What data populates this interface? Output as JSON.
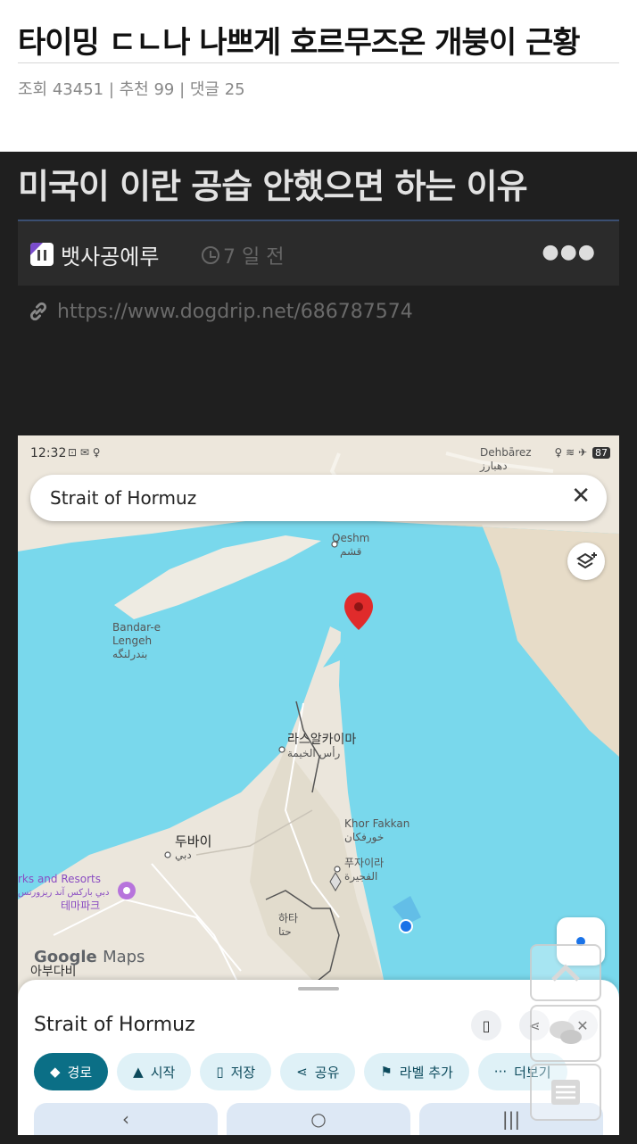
{
  "post": {
    "title": "타이밍 ㄷㄴ나 나쁘게 호르무즈온 개붕이 근황",
    "meta": "조회 43451 | 추천 99 | 댓글 25"
  },
  "screenshot": {
    "heading": "미국이 이란 공습 안했으면 하는 이유",
    "author": "뱃사공에루",
    "time_ago": "7 일 전",
    "more": "●●●",
    "link_url": "https://www.dogdrip.net/686787574"
  },
  "map": {
    "status_time": "12:32",
    "status_icons": "⊡ ✉ ♀",
    "status_right": "♀ ≋ ✈",
    "battery": "87",
    "search_text": "Strait of Hormuz",
    "close_symbol": "✕",
    "places": {
      "dehbarez": "Dehbārez",
      "dehbarez_fa": "دهبارز",
      "qeshm": "Qeshm",
      "qeshm_fa": "قشم",
      "bandar_lengeh": "Bandar-e\nLengeh",
      "bandar_lengeh_fa": "بندرلنگه",
      "ras_al_khaimah": "라스알카이마",
      "ras_al_khaimah_ar": "رأس الخيمة",
      "khor_fakkan": "Khor Fakkan",
      "khor_fakkan_ar": "خورفكان",
      "dubai": "두바이",
      "dubai_ar": "دبي",
      "fujairah": "푸자이라",
      "fujairah_ar": "الفجيرة",
      "hatta": "하타",
      "hatta_ar": "حتا",
      "parks": "rks and Resorts",
      "parks_ar": "دبي باركس آند ريزورتس",
      "theme_park": "테마파크",
      "abu_dhabi": "아부다비"
    },
    "google_logo": "Google",
    "maps_word": "Maps",
    "sheet": {
      "title": "Strait of Hormuz",
      "chips": [
        "경로",
        "시작",
        "저장",
        "공유",
        "라벨 추가",
        "더보기"
      ],
      "nav": [
        "‹",
        "○",
        "|||"
      ]
    }
  }
}
